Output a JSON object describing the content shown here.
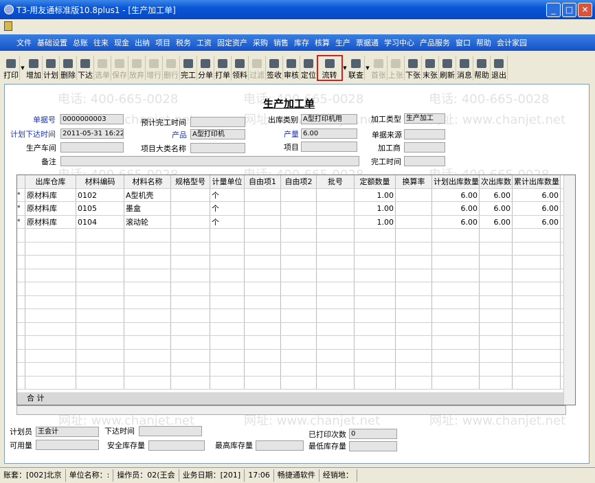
{
  "window": {
    "title": "T3-用友通标准版10.8plus1 - [生产加工单]"
  },
  "watermarks": {
    "phone": "电话: 400-665-0028",
    "site": "网址: www.chanjet.net"
  },
  "menu": [
    "文件",
    "基础设置",
    "总账",
    "往来",
    "现金",
    "出纳",
    "项目",
    "税务",
    "工资",
    "固定资产",
    "采购",
    "销售",
    "库存",
    "核算",
    "生产",
    "票据通",
    "学习中心",
    "产品服务",
    "窗口",
    "帮助",
    "会计家园"
  ],
  "toolbar": [
    {
      "label": "打印",
      "dd": true
    },
    {
      "label": "增加"
    },
    {
      "label": "计划"
    },
    {
      "label": "删除"
    },
    {
      "label": "下达"
    },
    {
      "label": "选单",
      "disabled": true
    },
    {
      "label": "保存",
      "disabled": true
    },
    {
      "label": "放弃",
      "disabled": true
    },
    {
      "label": "增行",
      "disabled": true
    },
    {
      "label": "删行",
      "disabled": true
    },
    {
      "label": "完工"
    },
    {
      "label": "分单"
    },
    {
      "label": "打单"
    },
    {
      "label": "领料"
    },
    {
      "label": "过滤",
      "disabled": true
    },
    {
      "label": "签收"
    },
    {
      "label": "审核"
    },
    {
      "label": "定位"
    },
    {
      "label": "流转",
      "dd": true,
      "highlight": true
    },
    {
      "label": "联查",
      "dd": true
    },
    {
      "label": "首张",
      "disabled": true
    },
    {
      "label": "上张",
      "disabled": true
    },
    {
      "label": "下张"
    },
    {
      "label": "末张"
    },
    {
      "label": "刷新"
    },
    {
      "label": "消息"
    },
    {
      "label": "帮助"
    },
    {
      "label": "退出"
    }
  ],
  "form": {
    "title": "生产加工单",
    "doc_no_label": "单据号",
    "doc_no": "0000000003",
    "est_finish_label": "预计完工时间",
    "est_finish": "",
    "out_type_label": "出库类别",
    "out_type": "A型打印机用",
    "proc_type_label": "加工类型",
    "proc_type": "生产加工",
    "plan_time_label": "计划下达时间",
    "plan_time": "2011-05-31 16:22",
    "product_label": "产品",
    "product": "A型打印机",
    "qty_label": "产量",
    "qty": "6.00",
    "source_label": "单据来源",
    "source": "",
    "workshop_label": "生产车间",
    "workshop": "",
    "proj_cat_label": "项目大类名称",
    "proj_cat": "",
    "project_label": "项目",
    "project": "",
    "processor_label": "加工商",
    "processor": "",
    "remark_label": "备注",
    "remark": "",
    "finish_time_label": "完工时间",
    "finish_time": ""
  },
  "grid": {
    "columns": [
      "出库仓库",
      "材料编码",
      "材料名称",
      "规格型号",
      "计量单位",
      "自由项1",
      "自由项2",
      "批号",
      "定额数量",
      "换算率",
      "计划出库数量",
      "次出库数",
      "累计出库数量"
    ],
    "rows": [
      [
        "原材料库",
        "0102",
        "A型机壳",
        "",
        "个",
        "",
        "",
        "",
        "1.00",
        "",
        "6.00",
        "6.00",
        "6.00"
      ],
      [
        "原材料库",
        "0105",
        "墨盒",
        "",
        "个",
        "",
        "",
        "",
        "1.00",
        "",
        "6.00",
        "6.00",
        "6.00"
      ],
      [
        "原材料库",
        "0104",
        "滚动轮",
        "",
        "个",
        "",
        "",
        "",
        "1.00",
        "",
        "6.00",
        "6.00",
        "6.00"
      ]
    ],
    "row_marker": "*",
    "total_label": "合  计"
  },
  "footer": {
    "planner_label": "计划员",
    "planner": "王会计",
    "issue_time_label": "下达时间",
    "issue_time": "",
    "printed_label": "已打印次数",
    "printed": "0",
    "avail_label": "可用量",
    "avail": "",
    "safety_label": "安全库存量",
    "safety": "",
    "max_label": "最高库存量",
    "max": "",
    "min_label": "最低库存量",
    "min": ""
  },
  "status": [
    "账套：[002]北京",
    "单位名称：:",
    "操作员：02(王会",
    "业务日期：[201]",
    "17:06",
    "畅捷通软件",
    "经销地："
  ]
}
